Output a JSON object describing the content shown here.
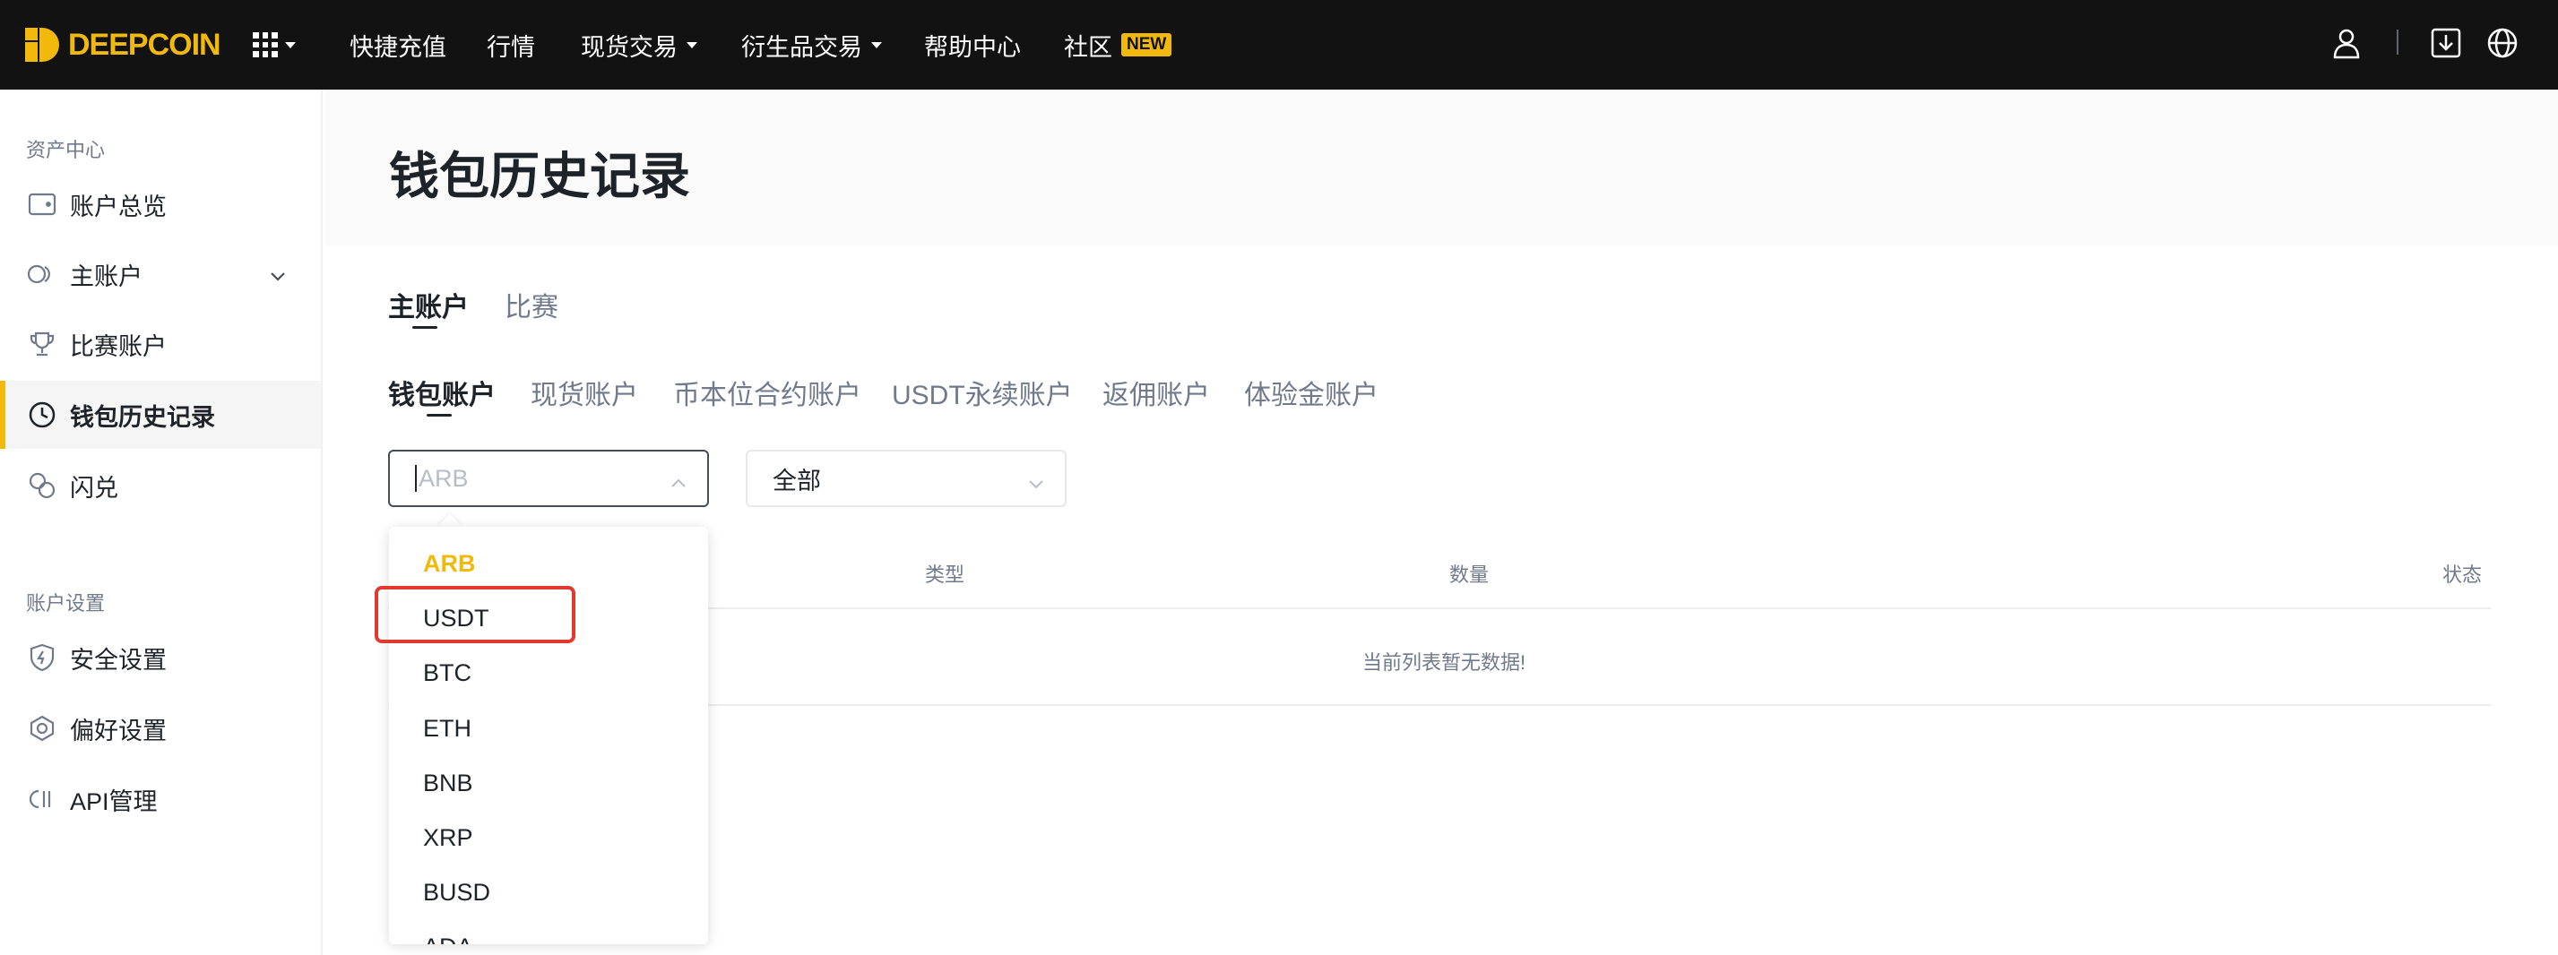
{
  "brand": {
    "name": "DEEPCOIN",
    "accent": "#f0b90b",
    "topbar_bg": "#121212"
  },
  "topnav": {
    "items": [
      "快捷充值",
      "行情",
      "现货交易",
      "衍生品交易",
      "帮助中心",
      "社区"
    ],
    "new_badge": "NEW",
    "icons": [
      "user-icon",
      "download-icon",
      "globe-icon"
    ]
  },
  "sidebar": {
    "group1": "资产中心",
    "items1": [
      "账户总览",
      "主账户",
      "比赛账户",
      "钱包历史记录",
      "闪兑"
    ],
    "group2": "账户设置",
    "items2": [
      "安全设置",
      "偏好设置",
      "API管理"
    ]
  },
  "page": {
    "title": "钱包历史记录"
  },
  "tabs_primary": {
    "items": [
      "主账户",
      "比赛"
    ],
    "active": "主账户"
  },
  "tabs_secondary": {
    "items": [
      "钱包账户",
      "现货账户",
      "币本位合约账户",
      "USDT永续账户",
      "返佣账户",
      "体验金账户"
    ],
    "active": "钱包账户"
  },
  "filters": {
    "coin_placeholder": "ARB",
    "type_value": "全部"
  },
  "table": {
    "headers": [
      "类型",
      "数量",
      "状态"
    ],
    "empty_message": "当前列表暂无数据!"
  },
  "coin_dropdown": {
    "options": [
      "ARB",
      "USDT",
      "BTC",
      "ETH",
      "BNB",
      "XRP",
      "BUSD",
      "ADA"
    ],
    "selected": "ARB",
    "highlighted": "USDT"
  }
}
